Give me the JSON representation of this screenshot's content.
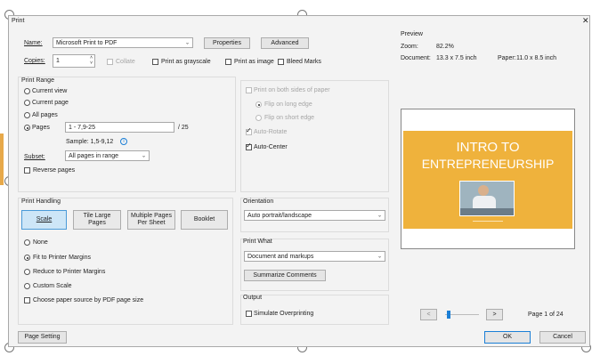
{
  "window": {
    "title": "Print"
  },
  "printer": {
    "name_label": "Name:",
    "name_value": "Microsoft Print to PDF",
    "properties_label": "Properties",
    "advanced_label": "Advanced"
  },
  "copies": {
    "label": "Copies:",
    "value": "1",
    "collate_label": "Collate",
    "grayscale_label": "Print as grayscale",
    "image_label": "Print as image",
    "bleed_label": "Bleed Marks"
  },
  "print_range": {
    "title": "Print Range",
    "current_view": "Current view",
    "current_page": "Current page",
    "all_pages": "All pages",
    "pages_label": "Pages",
    "pages_value": "1 - 7,9-25",
    "pages_total": "/ 25",
    "sample": "Sample: 1,5-9,12",
    "subset_label": "Subset:",
    "subset_value": "All pages in range",
    "reverse_label": "Reverse pages"
  },
  "sides": {
    "both_sides": "Print on both sides of paper",
    "long_edge": "Flip on long edge",
    "short_edge": "Flip on short edge",
    "auto_rotate": "Auto-Rotate",
    "auto_center": "Auto-Center"
  },
  "handling": {
    "title": "Print Handling",
    "scale": "Scale",
    "tile": "Tile Large Pages",
    "multiple": "Multiple Pages Per Sheet",
    "booklet": "Booklet",
    "none": "None",
    "fit": "Fit to Printer Margins",
    "reduce": "Reduce to Printer Margins",
    "custom": "Custom Scale",
    "paper_source": "Choose paper source by PDF page size"
  },
  "orientation": {
    "title": "Orientation",
    "value": "Auto portrait/landscape"
  },
  "print_what": {
    "title": "Print What",
    "value": "Document and markups",
    "summarize": "Summarize Comments"
  },
  "output": {
    "title": "Output",
    "simulate": "Simulate Overprinting"
  },
  "preview": {
    "title": "Preview",
    "zoom_label": "Zoom:",
    "zoom_value": "82.2%",
    "document_label": "Document:",
    "document_value": "13.3 x 7.5 inch",
    "paper_label": "Paper:",
    "paper_value": "11.0 x 8.5 inch",
    "slide_title_1": "INTRO TO",
    "slide_title_2": "ENTREPRENEURSHIP",
    "prev": "<",
    "next": ">",
    "page_indicator": "Page 1 of 24",
    "page_progress": 0.04
  },
  "footer": {
    "page_setting": "Page Setting",
    "ok": "OK",
    "cancel": "Cancel"
  },
  "colors": {
    "slide_bg": "#efb23c",
    "accent_blue": "#1b7fd6",
    "selected_bg": "#cde6f7"
  }
}
